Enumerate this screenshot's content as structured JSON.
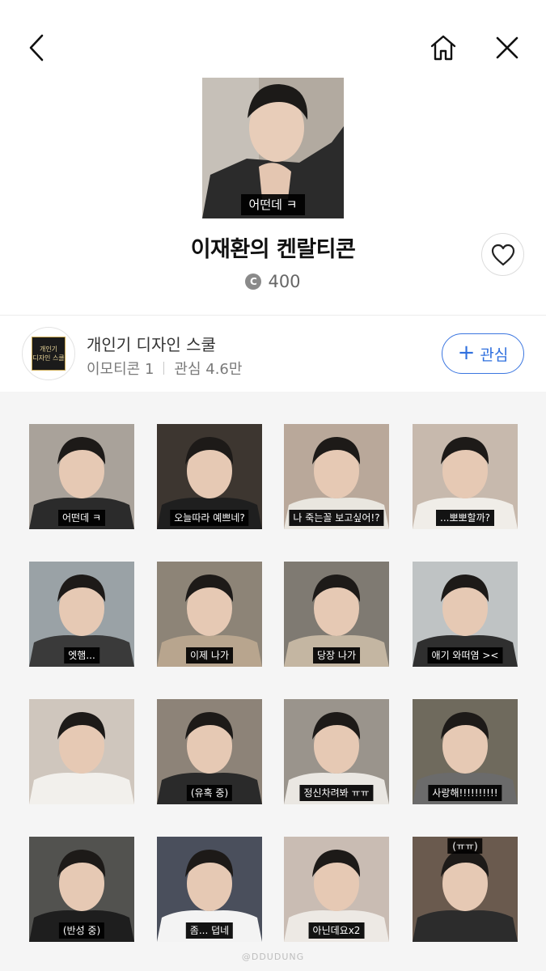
{
  "header": {
    "back_icon": "chevron-left-icon",
    "home_icon": "home-icon",
    "close_icon": "close-icon"
  },
  "product": {
    "hero_caption": "어떤데 ㅋ",
    "title": "이재환의 켄랄티콘",
    "coin_symbol": "C",
    "price": "400",
    "like_icon": "heart-outline-icon"
  },
  "creator": {
    "avatar_text_line1": "개인기",
    "avatar_text_line2": "디자인 스쿨",
    "name": "개인기 디자인 스쿨",
    "emoticon_label": "이모티콘 1",
    "interest_label": "관심 4.6만",
    "follow_label": "관심"
  },
  "stickers": [
    {
      "caption": "어떤데 ㅋ",
      "bg": "#a9a29a",
      "shirt": "#2b2b2b"
    },
    {
      "caption": "오늘따라 예쁘네?",
      "bg": "#3d3630",
      "shirt": "#1f1f1f"
    },
    {
      "caption": "나 죽는꼴 보고싶어!?",
      "bg": "#b9a89a",
      "shirt": "#e9e6df"
    },
    {
      "caption": "...뽀뽀할까?",
      "bg": "#c7b9ad",
      "shirt": "#f0ede8"
    },
    {
      "caption": "엣햄...",
      "bg": "#9aa2a6",
      "shirt": "#3a3a3a"
    },
    {
      "caption": "이제 나가",
      "bg": "#8d8477",
      "shirt": "#b8a58e"
    },
    {
      "caption": "당장 나가",
      "bg": "#7f7a72",
      "shirt": "#c4b6a2"
    },
    {
      "caption": "애기 와떠염 ><",
      "bg": "#bfc3c4",
      "shirt": "#2f2f2f"
    },
    {
      "caption": "",
      "bg": "#cfc6bd",
      "shirt": "#f2f0ec"
    },
    {
      "caption": "(유혹 중)",
      "bg": "#8d8378",
      "shirt": "#2a2a2a"
    },
    {
      "caption": "정신차려봐 ㅠㅠ",
      "bg": "#9a948c",
      "shirt": "#eae7e2"
    },
    {
      "caption": "사랑해!!!!!!!!!!",
      "bg": "#6f6a5d",
      "shirt": "#6b6b6b"
    },
    {
      "caption": "(반성 중)",
      "bg": "#52524f",
      "shirt": "#1e1e1e"
    },
    {
      "caption": "좀... 덥네",
      "bg": "#4a4f5c",
      "shirt": "#f3f3f3"
    },
    {
      "caption": "아닌데요x2",
      "bg": "#c9bcb3",
      "shirt": "#ede9e4"
    },
    {
      "caption": "(ㅠㅠ)",
      "bg": "#6a5a4e",
      "shirt": "#2c2c2c"
    }
  ],
  "watermark": "@DDUDUNG"
}
